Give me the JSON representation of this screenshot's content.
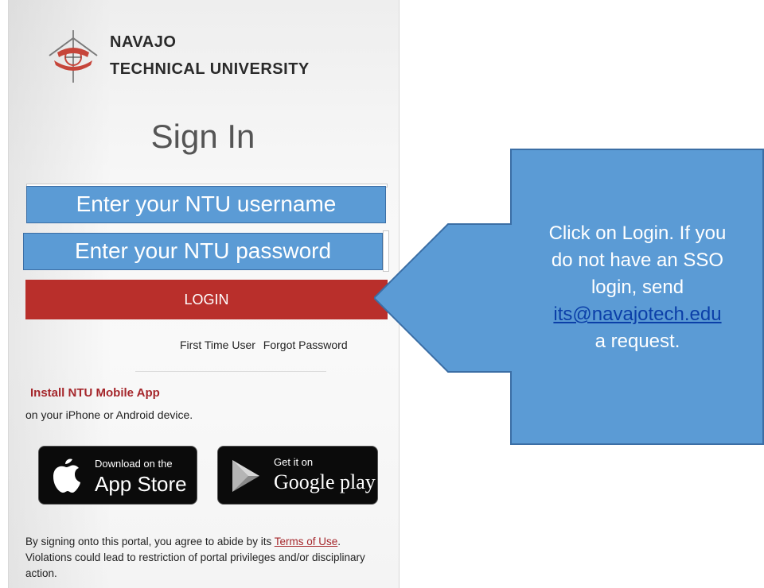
{
  "logo": {
    "line1": "NAVAJO",
    "line2": "TECHNICAL UNIVERSITY"
  },
  "signin": {
    "title": "Sign In",
    "username_placeholder": "Enter your NTU username",
    "password_placeholder": "Enter your NTU password",
    "login_label": "LOGIN",
    "first_time_user": "First Time User",
    "forgot_password": "Forgot Password"
  },
  "mobile": {
    "title": "Install NTU Mobile App",
    "subtitle": "on your iPhone or Android device.",
    "appstore_small": "Download on the",
    "appstore_big": "App Store",
    "google_small": "Get it on",
    "google_big": "Google play"
  },
  "terms": {
    "before": "By signing onto this portal, you agree to abide by its ",
    "link": "Terms of Use",
    "after": ". Violations could lead to restriction of portal privileges and/or disciplinary action."
  },
  "callout": {
    "line1": "Click on Login. If you",
    "line2": "do not have an SSO",
    "line3": "login, send",
    "email": "its@navajotech.edu",
    "line5": "a request."
  },
  "colors": {
    "login_red": "#b92f2b",
    "accent_blue": "#5b9bd5",
    "link_red": "#a5262b"
  }
}
